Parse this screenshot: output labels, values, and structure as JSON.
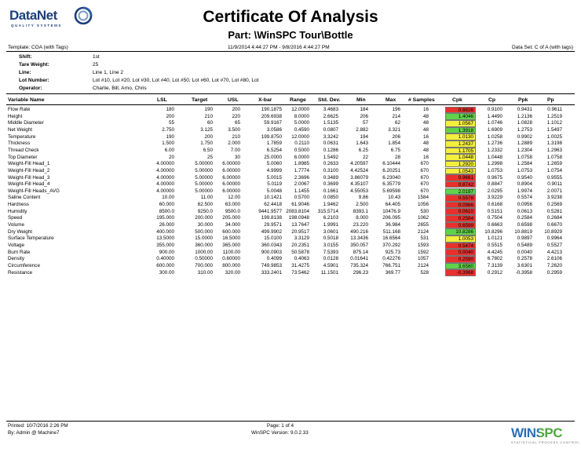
{
  "header": {
    "logo_text": "DataNet",
    "logo_sub": "QUALITY SYSTEMS",
    "title": "Certificate Of Analysis",
    "part": "Part: \\WinSPC Tour\\Bottle",
    "template": "Template:  COA  (with  Tags)",
    "date_range": "11/9/2014    4:44:27   PM  -  9/8/2016   4:44:27   PM",
    "data_set": "Data Set:  C  of  A  (with tags)"
  },
  "details": [
    {
      "label": "Shift:",
      "value": "1st"
    },
    {
      "label": "Tare Weight:",
      "value": "25"
    },
    {
      "label": "Line:",
      "value": "Line  1,  Line  2"
    },
    {
      "label": "Lot Number:",
      "value": "Lot  #10,  Lot  #20,  Lot  #30,  Lot  #40,  Lot  #50,  Lot  #60,  Lot  #70,  Lot  #80,  Lot"
    },
    {
      "label": "Operator:",
      "value": "Charlie,  Bill,  Arno,  Chris"
    }
  ],
  "columns": [
    "Variable Name",
    "LSL",
    "Target",
    "USL",
    "X-bar",
    "Range",
    "Std. Dev.",
    "Min",
    "Max",
    "# Samples",
    "Cpk",
    "Cp",
    "Ppk",
    "Pp"
  ],
  "colors": {
    "red": "#e8302c",
    "yellow": "#f4ef3a",
    "green": "#5fd34a"
  },
  "rows": [
    {
      "name": "Flow  Rate",
      "lsl": "180",
      "target": "190",
      "usl": "200",
      "xbar": "190.1875",
      "range": "12.0000",
      "sd": "3.4683",
      "min": "184",
      "max": "196",
      "n": "16",
      "cpk": "0.8826",
      "cpk_color": "red",
      "cp": "0.9100",
      "ppk": "0.9431",
      "pp": "0.9611"
    },
    {
      "name": "Height",
      "lsl": "200",
      "target": "210",
      "usl": "220",
      "xbar": "209.6938",
      "range": "8.0000",
      "sd": "2.6625",
      "min": "206",
      "max": "214",
      "n": "48",
      "cpk": "1.4046",
      "cpk_color": "green",
      "cp": "1.4490",
      "ppk": "1.2136",
      "pp": "1.2519"
    },
    {
      "name": "Middle  Diameter",
      "lsl": "55",
      "target": "60",
      "usl": "65",
      "xbar": "59.9167",
      "range": "5.0000",
      "sd": "1.5135",
      "min": "57",
      "max": "62",
      "n": "48",
      "cpk": "1.0567",
      "cpk_color": "yellow",
      "cp": "1.0746",
      "ppk": "1.0828",
      "pp": "1.1012"
    },
    {
      "name": "Net  Weight",
      "lsl": "2.750",
      "target": "3.125",
      "usl": "3.500",
      "xbar": "3.0586",
      "range": "0.4590",
      "sd": "0.0807",
      "min": "2.882",
      "max": "3.321",
      "n": "48",
      "cpk": "1.3918",
      "cpk_color": "green",
      "cp": "1.6909",
      "ppk": "1.2753",
      "pp": "1.5497"
    },
    {
      "name": "Temperature",
      "lsl": "190",
      "target": "200",
      "usl": "210",
      "xbar": "199.8750",
      "range": "12.0000",
      "sd": "3.3242",
      "min": "194",
      "max": "206",
      "n": "16",
      "cpk": "1.0130",
      "cpk_color": "yellow",
      "cp": "1.0258",
      "ppk": "0.9902",
      "pp": "1.0025"
    },
    {
      "name": "Thickness",
      "lsl": "1.500",
      "target": "1.750",
      "usl": "2.000",
      "xbar": "1.7859",
      "range": "0.2110",
      "sd": "0.0631",
      "min": "1.643",
      "max": "1.854",
      "n": "48",
      "cpk": "1.2437",
      "cpk_color": "yellow",
      "cp": "1.2736",
      "ppk": "1.2889",
      "pp": "1.3198"
    },
    {
      "name": "Thread  Check",
      "lsl": "6.00",
      "target": "6.50",
      "usl": "7.00",
      "xbar": "6.5254",
      "range": "0.5000",
      "sd": "0.1286",
      "min": "6.25",
      "max": "6.75",
      "n": "48",
      "cpk": "1.1705",
      "cpk_color": "yellow",
      "cp": "1.2332",
      "ppk": "1.2304",
      "pp": "1.2963"
    },
    {
      "name": "Top  Diameter",
      "lsl": "20",
      "target": "25",
      "usl": "30",
      "xbar": "25.0000",
      "range": "6.0000",
      "sd": "1.5492",
      "min": "22",
      "max": "28",
      "n": "16",
      "cpk": "1.0448",
      "cpk_color": "yellow",
      "cp": "1.0448",
      "ppk": "1.0758",
      "pp": "1.0758"
    },
    {
      "name": "Weight-Fill  Head_1",
      "lsl": "4.00000",
      "target": "5.00000",
      "usl": "6.00000",
      "xbar": "5.0060",
      "range": "1.8985",
      "sd": "0.2633",
      "min": "4.20597",
      "max": "6.10444",
      "n": "670",
      "cpk": "1.2920",
      "cpk_color": "yellow",
      "cp": "1.2998",
      "ppk": "1.2584",
      "pp": "1.2659"
    },
    {
      "name": "Weight-Fill  Head_2",
      "lsl": "4.00000",
      "target": "5.00000",
      "usl": "6.00000",
      "xbar": "4.9999",
      "range": "1.7774",
      "sd": "0.3100",
      "min": "4.42524",
      "max": "6.20251",
      "n": "670",
      "cpk": "1.0543",
      "cpk_color": "yellow",
      "cp": "1.0753",
      "ppk": "1.0753",
      "pp": "1.0754"
    },
    {
      "name": "Weight-Fill  Head_3",
      "lsl": "4.00000",
      "target": "5.00000",
      "usl": "6.00000",
      "xbar": "5.0015",
      "range": "2.3696",
      "sd": "0.3489",
      "min": "3.86079",
      "max": "6.23040",
      "n": "670",
      "cpk": "0.9661",
      "cpk_color": "red",
      "cp": "0.9675",
      "ppk": "0.9540",
      "pp": "0.9555"
    },
    {
      "name": "Weight-Fill  Head_4",
      "lsl": "4.00000",
      "target": "5.00000",
      "usl": "6.00000",
      "xbar": "5.0119",
      "range": "2.0067",
      "sd": "0.3699",
      "min": "4.35107",
      "max": "6.35779",
      "n": "670",
      "cpk": "0.8742",
      "cpk_color": "red",
      "cp": "0.8847",
      "ppk": "0.8904",
      "pp": "0.9011"
    },
    {
      "name": "Weight-Fill  Heads_AVG",
      "lsl": "4.00000",
      "target": "5.00000",
      "usl": "6.00000",
      "xbar": "5.0048",
      "range": "1.1455",
      "sd": "0.1661",
      "min": "4.55053",
      "max": "5.69598",
      "n": "670",
      "cpk": "2.0197",
      "cpk_color": "green",
      "cp": "2.0295",
      "ppk": "1.9974",
      "pp": "2.0071"
    },
    {
      "name": "Saline  Content",
      "lsl": "10.00",
      "target": "11.00",
      "usl": "12.00",
      "xbar": "10.1421",
      "range": "0.5700",
      "sd": "0.0850",
      "min": "9.86",
      "max": "10.43",
      "n": "1584",
      "cpk": "0.5578",
      "cpk_color": "red",
      "cp": "3.9229",
      "ppk": "0.5574",
      "pp": "3.9238"
    },
    {
      "name": "Hardness",
      "lsl": "60.000",
      "target": "62.500",
      "usl": "63.000",
      "xbar": "62.4418",
      "range": "61.9046",
      "sd": "1.9462",
      "min": "2.500",
      "max": "64.405",
      "n": "1056",
      "cpk": "0.0966",
      "cpk_color": "red",
      "cp": "0.6168",
      "ppk": "0.0956",
      "pp": "0.2569"
    },
    {
      "name": "Humidity",
      "lsl": "8500.0",
      "target": "9250.0",
      "usl": "9500.0",
      "xbar": "9441.9577",
      "range": "2083.8104",
      "sd": "315.5714",
      "min": "8393.1",
      "max": "10476.9",
      "n": "530",
      "cpk": "0.0610",
      "cpk_color": "red",
      "cp": "0.5151",
      "ppk": "0.0613",
      "pp": "0.5281"
    },
    {
      "name": "Speed",
      "lsl": "195.000",
      "target": "200.000",
      "usl": "205.000",
      "xbar": "199.8138",
      "range": "198.0948",
      "sd": "6.2103",
      "min": "8.000",
      "max": "206.095",
      "n": "1062",
      "cpk": "0.2584",
      "cpk_color": "red",
      "cp": "0.7504",
      "ppk": "0.2584",
      "pp": "0.2684"
    },
    {
      "name": "Volume",
      "lsl": "26.000",
      "target": "30.000",
      "usl": "34.000",
      "xbar": "29.9571",
      "range": "13.7647",
      "sd": "1.9991",
      "min": "23.220",
      "max": "36.984",
      "n": "2655",
      "cpk": "0.6599",
      "cpk_color": "red",
      "cp": "0.6663",
      "ppk": "0.6598",
      "pp": "0.6670"
    },
    {
      "name": "Dry  Weight",
      "lsl": "400.000",
      "target": "500.000",
      "usl": "600.000",
      "xbar": "499.9902",
      "range": "20.9517",
      "sd": "3.0601",
      "min": "490.216",
      "max": "511.168",
      "n": "2124",
      "cpk": "10.8286",
      "cpk_color": "green",
      "cp": "10.8296",
      "ppk": "10.8819",
      "pp": "10.8929"
    },
    {
      "name": "Surface  Temperature",
      "lsl": "13.5000",
      "target": "15.0000",
      "usl": "16.5000",
      "xbar": "15.0100",
      "range": "3.3129",
      "sd": "0.5018",
      "min": "13.3436",
      "max": "16.6564",
      "n": "531",
      "cpk": "1.0053",
      "cpk_color": "yellow",
      "cp": "1.0121",
      "ppk": "0.9897",
      "pp": "0.9964"
    },
    {
      "name": "Voltage",
      "lsl": "355.000",
      "target": "360.000",
      "usl": "365.000",
      "xbar": "360.0343",
      "range": "20.2351",
      "sd": "3.0155",
      "min": "350.057",
      "max": "370.292",
      "n": "1593",
      "cpk": "0.5474",
      "cpk_color": "red",
      "cp": "0.5515",
      "ppk": "0.5489",
      "pp": "0.5527"
    },
    {
      "name": "Burn  Rate",
      "lsl": "900.00",
      "target": "1000.00",
      "usl": "1100.00",
      "xbar": "900.0903",
      "range": "50.5878",
      "sd": "7.5393",
      "min": "875.14",
      "max": "925.73",
      "n": "1592",
      "cpk": "0.0040",
      "cpk_color": "red",
      "cp": "4.4245",
      "ppk": "0.0040",
      "pp": "4.4213"
    },
    {
      "name": "Density",
      "lsl": "0.40000",
      "target": "0.50000",
      "usl": "0.60000",
      "xbar": "0.4099",
      "range": "0.4063",
      "sd": "0.0128",
      "min": "0.01641",
      "max": "0.42276",
      "n": "1057",
      "cpk": "0.2590",
      "cpk_color": "red",
      "cp": "6.7802",
      "ppk": "0.2578",
      "pp": "2.6106"
    },
    {
      "name": "Circumference",
      "lsl": "600.000",
      "target": "700.000",
      "usl": "800.000",
      "xbar": "749.9853",
      "range": "31.4275",
      "sd": "4.5901",
      "min": "735.324",
      "max": "766.751",
      "n": "2124",
      "cpk": "3.6580",
      "cpk_color": "green",
      "cp": "7.3139",
      "ppk": "3.6301",
      "pp": "7.2620"
    },
    {
      "name": "Resistance",
      "lsl": "300.00",
      "target": "310.00",
      "usl": "320.00",
      "xbar": "333.2401",
      "range": "73.5462",
      "sd": "11.1501",
      "min": "296.23",
      "max": "369.77",
      "n": "528",
      "cpk": "-0.3968",
      "cpk_color": "red",
      "cp": "0.2912",
      "ppk": "-0.3958",
      "pp": "0.2959"
    }
  ],
  "footer": {
    "printed": "Printed:  10/7/2016  2:26  PM",
    "by": "By:   Admin    @    Machine7",
    "page": "Page:  1  of  4",
    "version": "WinSPC    Version:    9.0.2.33",
    "brand": "WINSPC",
    "brand_sub": "STATISTICAL PROCESS CONTROL"
  }
}
